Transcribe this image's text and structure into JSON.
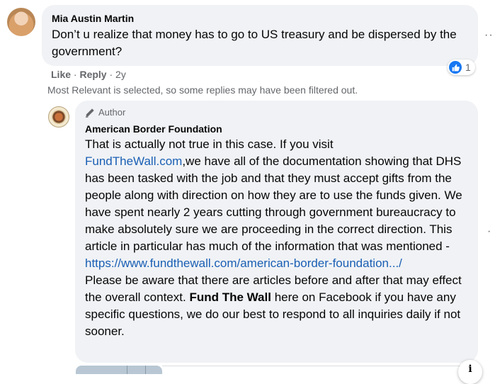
{
  "comment": {
    "author": "Mia Austin Martin",
    "text": "Don’t u realize that money has to go to US treasury and be dispersed by the government?",
    "actions": {
      "like": "Like",
      "reply": "Reply",
      "time": "2y"
    },
    "reaction_count": "1",
    "more_icon": "more-dots-icon"
  },
  "filter_note": "Most Relevant is selected, so some replies may have been filtered out.",
  "reply": {
    "badge": "Author",
    "author": "American Border Foundation",
    "text_1": "That is actually not true in this case. If you visit",
    "link_1": "FundTheWall.com",
    "text_2": ",we have all of the documentation showing that DHS has been tasked with the job and that they must accept gifts from the people along with direction on how they are to use the funds given. We have spent nearly 2 years cutting through government bureaucracy to make absolutely sure we are proceeding in the correct direction. This article in particular has much of the information that was mentioned -",
    "link_2": "https://www.fundthewall.com/american-border-foundation.../",
    "text_3": "Please be aware that there are articles before and after that may effect the overall context.",
    "bold_page": "Fund The Wall",
    "text_4": "here on Facebook if you have any specific questions, we do our best to respond to all inquiries daily if not sooner.",
    "more_icon": "more-dots-icon"
  },
  "info_button": "i",
  "colors": {
    "link": "#1a5fb4",
    "like_blue": "#1877f2",
    "bubble": "#f0f2f5",
    "meta_gray": "#65676b"
  }
}
